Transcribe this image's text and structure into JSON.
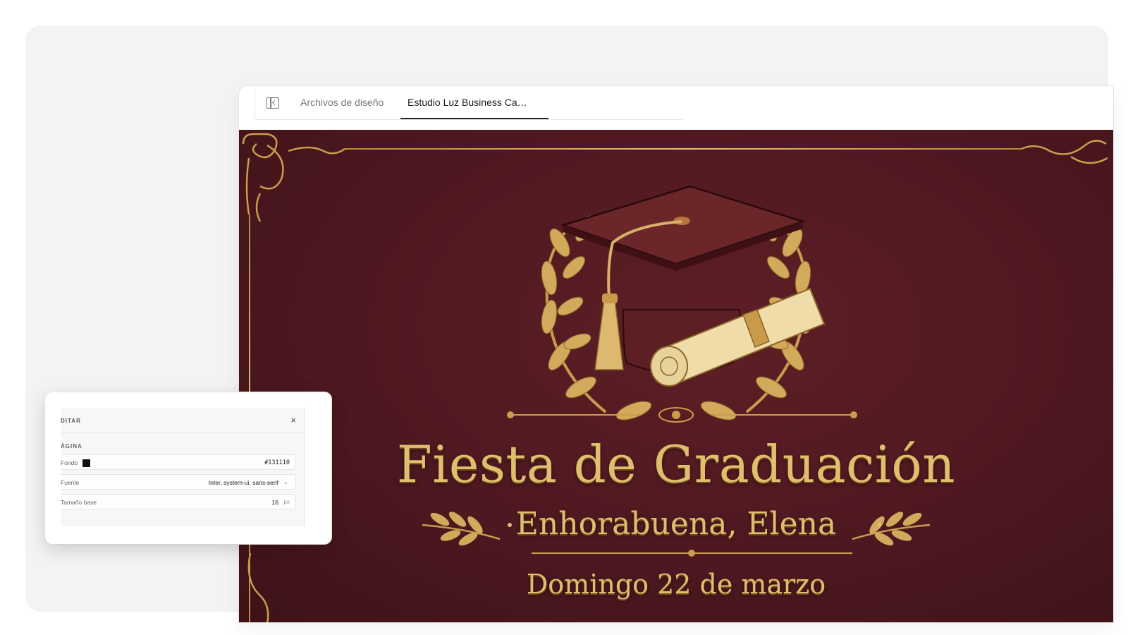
{
  "tabs": [
    {
      "label": "Archivos de diseño"
    },
    {
      "label": "Estudio Luz Business Ca…"
    }
  ],
  "card": {
    "title": "Fiesta de Graduación",
    "subtitle": "Enhorabuena, Elena",
    "date": "Domingo 22 de marzo"
  },
  "panel": {
    "title": "DITAR",
    "close": "×",
    "section": "ÁGINA",
    "rows": [
      {
        "label": "Fondo",
        "value": "#131110"
      },
      {
        "label": "Fuente",
        "value": "Inter, system-ui, sans-serif"
      },
      {
        "label": "Tamaño base",
        "value": "16",
        "unit": "px"
      }
    ]
  },
  "colors": {
    "card_background": "#4e1820",
    "gold": "#e1bd6e",
    "swatch": "#131110"
  },
  "icons": [
    "sidebar-toggle-icon",
    "close-icon",
    "chevron-down-icon",
    "graduation-cap-icon",
    "diploma-icon",
    "laurel-icon"
  ]
}
